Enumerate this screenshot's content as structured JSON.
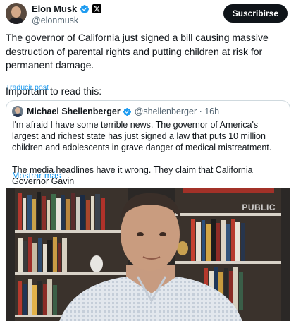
{
  "author": {
    "display_name": "Elon Musk",
    "handle": "@elonmusk",
    "badges": [
      "verified-check-icon",
      "x-affiliation-icon"
    ]
  },
  "subscribe_label": "Suscribirse",
  "tweet": {
    "text": "The governor of California just signed a bill causing massive destruction of parental rights and putting children at risk for permanent damage.",
    "text2": "Important to read this:",
    "translate_label": "Traducir post"
  },
  "quoted": {
    "display_name": "Michael Shellenberger",
    "handle_time": "@shellenberger · 16h",
    "paragraph1": "I'm afraid I have some terrible news. The governor of America's largest and richest state has just signed a law that puts 10 million children and adolescents in grave danger of medical mistreatment.",
    "paragraph2": "The media headlines have it wrong. They claim that California Governor Gavin",
    "show_more_label": "Mostrar más",
    "video_watermark": "PUBLIC"
  },
  "colors": {
    "link": "#1d9bf0",
    "verified": "#1d9bf0",
    "button_bg": "#0f1419",
    "secondary_text": "#536471"
  }
}
